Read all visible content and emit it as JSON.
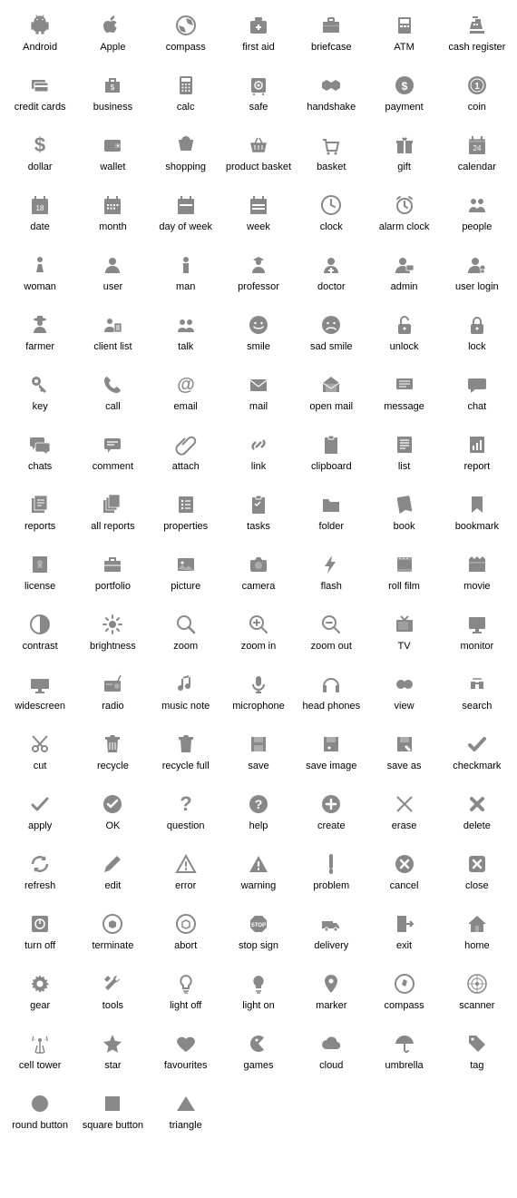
{
  "icons": [
    {
      "label": "Android",
      "svg": "android"
    },
    {
      "label": "Apple",
      "svg": "apple"
    },
    {
      "label": "compass",
      "svg": "compass"
    },
    {
      "label": "first aid",
      "svg": "firstaid"
    },
    {
      "label": "briefcase",
      "svg": "briefcase"
    },
    {
      "label": "ATM",
      "svg": "atm"
    },
    {
      "label": "cash register",
      "svg": "cashreg"
    },
    {
      "label": "credit cards",
      "svg": "cards"
    },
    {
      "label": "business",
      "svg": "business"
    },
    {
      "label": "calc",
      "svg": "calc"
    },
    {
      "label": "safe",
      "svg": "safe"
    },
    {
      "label": "handshake",
      "svg": "handshake"
    },
    {
      "label": "payment",
      "svg": "payment"
    },
    {
      "label": "coin",
      "svg": "coin"
    },
    {
      "label": "dollar",
      "svg": "dollar"
    },
    {
      "label": "wallet",
      "svg": "wallet"
    },
    {
      "label": "shopping",
      "svg": "shopping"
    },
    {
      "label": "product basket",
      "svg": "pbasket"
    },
    {
      "label": "basket",
      "svg": "basket"
    },
    {
      "label": "gift",
      "svg": "gift"
    },
    {
      "label": "calendar",
      "svg": "calendar"
    },
    {
      "label": "date",
      "svg": "date"
    },
    {
      "label": "month",
      "svg": "month"
    },
    {
      "label": "day of week",
      "svg": "dow"
    },
    {
      "label": "week",
      "svg": "week"
    },
    {
      "label": "clock",
      "svg": "clock"
    },
    {
      "label": "alarm clock",
      "svg": "alarm"
    },
    {
      "label": "people",
      "svg": "people"
    },
    {
      "label": "woman",
      "svg": "woman"
    },
    {
      "label": "user",
      "svg": "user"
    },
    {
      "label": "man",
      "svg": "man"
    },
    {
      "label": "professor",
      "svg": "professor"
    },
    {
      "label": "doctor",
      "svg": "doctor"
    },
    {
      "label": "admin",
      "svg": "admin"
    },
    {
      "label": "user login",
      "svg": "userlogin"
    },
    {
      "label": "farmer",
      "svg": "farmer"
    },
    {
      "label": "client list",
      "svg": "clientlist"
    },
    {
      "label": "talk",
      "svg": "talk"
    },
    {
      "label": "smile",
      "svg": "smile"
    },
    {
      "label": "sad smile",
      "svg": "sad"
    },
    {
      "label": "unlock",
      "svg": "unlock"
    },
    {
      "label": "lock",
      "svg": "lock"
    },
    {
      "label": "key",
      "svg": "key"
    },
    {
      "label": "call",
      "svg": "call"
    },
    {
      "label": "email",
      "svg": "email"
    },
    {
      "label": "mail",
      "svg": "mail"
    },
    {
      "label": "open mail",
      "svg": "openmail"
    },
    {
      "label": "message",
      "svg": "message"
    },
    {
      "label": "chat",
      "svg": "chat"
    },
    {
      "label": "chats",
      "svg": "chats"
    },
    {
      "label": "comment",
      "svg": "comment"
    },
    {
      "label": "attach",
      "svg": "attach"
    },
    {
      "label": "link",
      "svg": "link"
    },
    {
      "label": "clipboard",
      "svg": "clipboard"
    },
    {
      "label": "list",
      "svg": "list"
    },
    {
      "label": "report",
      "svg": "report"
    },
    {
      "label": "reports",
      "svg": "reports"
    },
    {
      "label": "all reports",
      "svg": "allreports"
    },
    {
      "label": "properties",
      "svg": "properties"
    },
    {
      "label": "tasks",
      "svg": "tasks"
    },
    {
      "label": "folder",
      "svg": "folder"
    },
    {
      "label": "book",
      "svg": "book"
    },
    {
      "label": "bookmark",
      "svg": "bookmark"
    },
    {
      "label": "license",
      "svg": "license"
    },
    {
      "label": "portfolio",
      "svg": "portfolio"
    },
    {
      "label": "picture",
      "svg": "picture"
    },
    {
      "label": "camera",
      "svg": "camera"
    },
    {
      "label": "flash",
      "svg": "flash"
    },
    {
      "label": "roll film",
      "svg": "rollfilm"
    },
    {
      "label": "movie",
      "svg": "movie"
    },
    {
      "label": "contrast",
      "svg": "contrast"
    },
    {
      "label": "brightness",
      "svg": "brightness"
    },
    {
      "label": "zoom",
      "svg": "zoom"
    },
    {
      "label": "zoom in",
      "svg": "zoomin"
    },
    {
      "label": "zoom out",
      "svg": "zoomout"
    },
    {
      "label": "TV",
      "svg": "tv"
    },
    {
      "label": "monitor",
      "svg": "monitor"
    },
    {
      "label": "widescreen",
      "svg": "widescreen"
    },
    {
      "label": "radio",
      "svg": "radio"
    },
    {
      "label": "music note",
      "svg": "music"
    },
    {
      "label": "microphone",
      "svg": "mic"
    },
    {
      "label": "head phones",
      "svg": "headphones"
    },
    {
      "label": "view",
      "svg": "view"
    },
    {
      "label": "search",
      "svg": "search"
    },
    {
      "label": "cut",
      "svg": "cut"
    },
    {
      "label": "recycle",
      "svg": "recycle"
    },
    {
      "label": "recycle full",
      "svg": "recyclefull"
    },
    {
      "label": "save",
      "svg": "save"
    },
    {
      "label": "save image",
      "svg": "saveimg"
    },
    {
      "label": "save as",
      "svg": "saveas"
    },
    {
      "label": "checkmark",
      "svg": "checkmark"
    },
    {
      "label": "apply",
      "svg": "apply"
    },
    {
      "label": "OK",
      "svg": "ok"
    },
    {
      "label": "question",
      "svg": "question"
    },
    {
      "label": "help",
      "svg": "help"
    },
    {
      "label": "create",
      "svg": "create"
    },
    {
      "label": "erase",
      "svg": "erase"
    },
    {
      "label": "delete",
      "svg": "delete"
    },
    {
      "label": "refresh",
      "svg": "refresh"
    },
    {
      "label": "edit",
      "svg": "edit"
    },
    {
      "label": "error",
      "svg": "error"
    },
    {
      "label": "warning",
      "svg": "warning"
    },
    {
      "label": "problem",
      "svg": "problem"
    },
    {
      "label": "cancel",
      "svg": "cancel"
    },
    {
      "label": "close",
      "svg": "close"
    },
    {
      "label": "turn off",
      "svg": "turnoff"
    },
    {
      "label": "terminate",
      "svg": "terminate"
    },
    {
      "label": "abort",
      "svg": "abort"
    },
    {
      "label": "stop sign",
      "svg": "stopsign"
    },
    {
      "label": "delivery",
      "svg": "delivery"
    },
    {
      "label": "exit",
      "svg": "exit"
    },
    {
      "label": "home",
      "svg": "home"
    },
    {
      "label": "gear",
      "svg": "gear"
    },
    {
      "label": "tools",
      "svg": "tools"
    },
    {
      "label": "light off",
      "svg": "lightoff"
    },
    {
      "label": "light on",
      "svg": "lighton"
    },
    {
      "label": "marker",
      "svg": "marker"
    },
    {
      "label": "compass",
      "svg": "compass2"
    },
    {
      "label": "scanner",
      "svg": "scanner"
    },
    {
      "label": "cell tower",
      "svg": "celltower"
    },
    {
      "label": "star",
      "svg": "star"
    },
    {
      "label": "favourites",
      "svg": "heart"
    },
    {
      "label": "games",
      "svg": "games"
    },
    {
      "label": "cloud",
      "svg": "cloud"
    },
    {
      "label": "umbrella",
      "svg": "umbrella"
    },
    {
      "label": "tag",
      "svg": "tag"
    },
    {
      "label": "round button",
      "svg": "round"
    },
    {
      "label": "square button",
      "svg": "square"
    },
    {
      "label": "triangle",
      "svg": "triangle"
    }
  ]
}
